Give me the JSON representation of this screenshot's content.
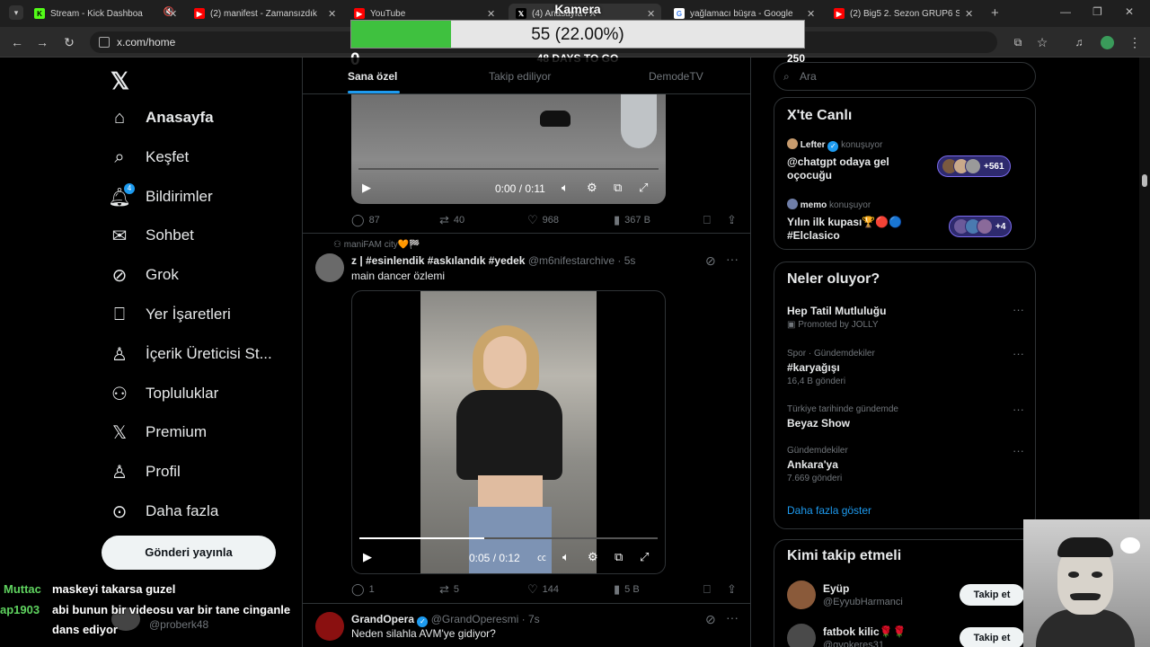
{
  "browser": {
    "tabs": [
      {
        "label": "Stream - Kick Dashboa",
        "icon": "kick-icon",
        "color": "#53fc18"
      },
      {
        "label": "(2) manifest - Zamansızdık",
        "icon": "youtube-icon",
        "color": "#ff0000"
      },
      {
        "label": "YouTube",
        "icon": "youtube-icon",
        "color": "#ff0000"
      },
      {
        "label": "(4) Anasayfa / X",
        "icon": "x-icon",
        "color": "#000000"
      },
      {
        "label": "yağlamacı büşra - Google",
        "icon": "google-icon",
        "color": "#4285f4"
      },
      {
        "label": "(2) Big5 2. Sezon GRUP6 S",
        "icon": "youtube-icon",
        "color": "#ff0000"
      }
    ],
    "url": "x.com/home"
  },
  "overlay": {
    "title": "Kamera",
    "progress_text": "55 (22.00%)",
    "progress_fraction": 0.22,
    "min_label": "0",
    "max_label": "250",
    "days_label": "48 DAYS TO GO"
  },
  "nav": {
    "logo": "X",
    "items": [
      {
        "label": "Anasayfa",
        "icon": "home-icon"
      },
      {
        "label": "Keşfet",
        "icon": "search-icon"
      },
      {
        "label": "Bildirimler",
        "icon": "bell-icon",
        "badge": "4"
      },
      {
        "label": "Sohbet",
        "icon": "mail-icon"
      },
      {
        "label": "Grok",
        "icon": "grok-icon"
      },
      {
        "label": "Yer İşaretleri",
        "icon": "bookmark-icon"
      },
      {
        "label": "İçerik Üreticisi St...",
        "icon": "creator-icon"
      },
      {
        "label": "Topluluklar",
        "icon": "communities-icon"
      },
      {
        "label": "Premium",
        "icon": "x-premium-icon"
      },
      {
        "label": "Profil",
        "icon": "profile-icon"
      },
      {
        "label": "Daha fazla",
        "icon": "more-icon"
      }
    ],
    "post_button": "Gönderi yayınla"
  },
  "chat": [
    {
      "user": "Muttac",
      "message": "maskeyi takarsa guzel"
    },
    {
      "user": "ap1903",
      "message": "abi bunun bir videosu var bir tane cinganle"
    },
    {
      "user": "",
      "message": "dans ediyor"
    }
  ],
  "mini_profile": {
    "handle": "@proberk48"
  },
  "feed": {
    "tabs": [
      "Sana özel",
      "Takip ediliyor",
      "DemodeTV"
    ],
    "tweet1": {
      "video_time": "0:00 / 0:11",
      "video_progress": 0,
      "replies": "87",
      "retweets": "40",
      "likes": "968",
      "views": "367 B"
    },
    "tweet2": {
      "context": "maniFAM city🧡🏁",
      "name": "z | #esinlendik #askılandık #yedek",
      "handle": "@m6nifestarchive",
      "time": "5s",
      "text": "main dancer özlemi",
      "video_time": "0:05 / 0:12",
      "video_progress": 0.42,
      "replies": "1",
      "retweets": "5",
      "likes": "144",
      "views": "5 B"
    },
    "tweet3": {
      "name": "GrandOpera",
      "handle": "@GrandOperesmi",
      "time": "7s",
      "text": "Neden silahla AVM'ye gidiyor?"
    }
  },
  "right": {
    "search_placeholder": "Ara",
    "live": {
      "title": "X'te Canlı",
      "items": [
        {
          "host": "Lefter",
          "status": "konuşuyor",
          "text": "@chatgpt odaya gel oçocuğu",
          "count": "+561"
        },
        {
          "host": "memo",
          "status": "konuşuyor",
          "text": "Yılın ilk kupası🏆🔴🔵 #Elclasico",
          "count": "+4"
        }
      ]
    },
    "trends": {
      "title": "Neler oluyor?",
      "items": [
        {
          "context": "",
          "name": "Hep Tatil Mutluluğu",
          "sub": "Promoted by JOLLY"
        },
        {
          "context": "Spor · Gündemdekiler",
          "name": "#karyağışı",
          "sub": "16,4 B gönderi"
        },
        {
          "context": "Türkiye tarihinde gündemde",
          "name": "Beyaz Show",
          "sub": ""
        },
        {
          "context": "Gündemdekiler",
          "name": "Ankara'ya",
          "sub": "7.669 gönderi"
        }
      ],
      "show_more": "Daha fazla göster"
    },
    "follow": {
      "title": "Kimi takip etmeli",
      "button": "Takip et",
      "items": [
        {
          "name": "Eyüp",
          "handle": "@EyyubHarmanci"
        },
        {
          "name": "fatbok kilic🌹🌹",
          "handle": "@gvokeres31"
        }
      ]
    }
  }
}
